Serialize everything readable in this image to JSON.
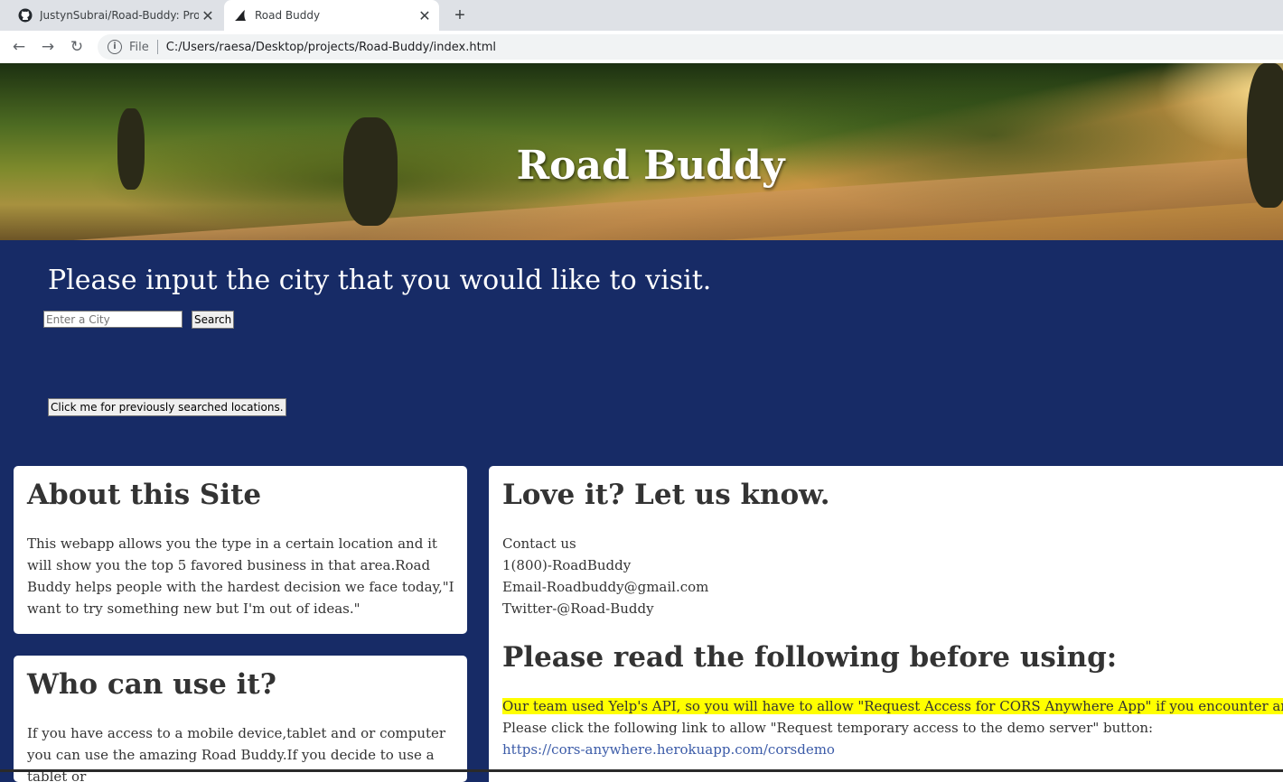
{
  "browser": {
    "tabs": [
      {
        "title": "JustynSubrai/Road-Buddy: Projec",
        "icon": "github-icon",
        "active": false
      },
      {
        "title": "Road Buddy",
        "icon": "shark-fin-icon",
        "active": true
      }
    ],
    "file_label": "File",
    "url": "C:/Users/raesa/Desktop/projects/Road-Buddy/index.html"
  },
  "header": {
    "title": "Road Buddy"
  },
  "search": {
    "prompt": "Please input the city that you would like to visit.",
    "placeholder": "Enter a City",
    "button_label": "Search",
    "history_button_label": "Click me for previously searched locations."
  },
  "about": {
    "heading": "About this Site",
    "body": "This webapp allows you the type in a certain location and it will show you the top 5 favored business in that area.Road Buddy helps people with the hardest decision we face today,\"I want to try something new but I'm out of ideas.\""
  },
  "who": {
    "heading": "Who can use it?",
    "body": "If you have access to a mobile device,tablet and or computer you can use the amazing Road Buddy.If you decide to use a tablet or"
  },
  "contact": {
    "heading": "Love it? Let us know.",
    "lines": [
      "Contact us",
      "1(800)-RoadBuddy",
      "Email-Roadbuddy@gmail.com",
      "Twitter-@Road-Buddy"
    ]
  },
  "notice": {
    "heading": "Please read the following before using:",
    "highlight": "Our team used Yelp's API, so you will have to allow \"Request Access for CORS Anywhere App\" if you encounter any issues.",
    "instruction": "Please click the following link to allow \"Request temporary access to the demo server\" button:",
    "link": "https://cors-anywhere.herokuapp.com/corsdemo"
  },
  "colors": {
    "page_background": "#172b66",
    "card_background": "#ffffff",
    "highlight": "#ffff00",
    "link": "#3b5ba8"
  }
}
